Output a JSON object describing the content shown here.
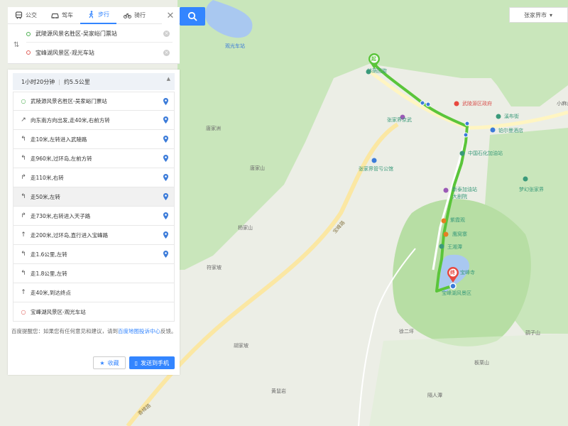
{
  "modes": [
    {
      "label": "公交",
      "icon": "bus-icon"
    },
    {
      "label": "驾车",
      "icon": "car-icon"
    },
    {
      "label": "步行",
      "icon": "walk-icon",
      "active": true
    },
    {
      "label": "骑行",
      "icon": "bike-icon"
    }
  ],
  "search": {
    "close": "✕"
  },
  "route": {
    "start": "武陵源风景名胜区-吴家峪门票站",
    "end": "宝峰湖风景区-观光车站"
  },
  "summary": {
    "duration": "1小时20分钟",
    "distance": "约5.5公里"
  },
  "steps": [
    {
      "text": "武陵源风景名胜区-吴家峪门票站",
      "type": "start",
      "pin": true
    },
    {
      "text": "向东南方向出发,走40米,右前方转",
      "type": "right-front",
      "pin": true
    },
    {
      "text": "走10米,左转进入武陵路",
      "type": "left",
      "pin": true
    },
    {
      "text": "走960米,过环岛,左前方转",
      "type": "left",
      "pin": true
    },
    {
      "text": "走110米,右转",
      "type": "right",
      "pin": true
    },
    {
      "text": "走50米,左转",
      "type": "left",
      "pin": true,
      "highlight": true
    },
    {
      "text": "走730米,右转进入天子路",
      "type": "right",
      "pin": true
    },
    {
      "text": "走200米,过环岛,直行进入宝峰路",
      "type": "straight",
      "pin": true
    },
    {
      "text": "走1.6公里,左转",
      "type": "left",
      "pin": true
    },
    {
      "text": "走1.8公里,左转",
      "type": "left",
      "pin": false
    },
    {
      "text": "走40米,到达终点",
      "type": "straight",
      "pin": false
    },
    {
      "text": "宝峰湖风景区-观光车站",
      "type": "end",
      "pin": false
    }
  ],
  "tip": {
    "text": "百度提醒您：如果您有任何意见和建议，请到",
    "link": "百度地图投诉中心",
    "tail": "反馈。"
  },
  "buttons": {
    "favorite": "收藏",
    "send": "发送到手机"
  },
  "city": {
    "label": "张家界市"
  },
  "map_labels": {
    "start_marker": "起",
    "end_marker": "终",
    "pois": [
      {
        "text": "林荫回旋",
        "kind": "poi"
      },
      {
        "text": "武陵源区政府",
        "kind": "red"
      },
      {
        "text": "溪布街",
        "kind": "poi"
      },
      {
        "text": "张家界京武",
        "kind": "poi"
      },
      {
        "text": "铂尔曼酒店",
        "kind": "poi"
      },
      {
        "text": "中国石化加油站",
        "kind": "poi"
      },
      {
        "text": "张家界管亏公馆",
        "kind": "poi"
      },
      {
        "text": "新泰加油站",
        "kind": "poi"
      },
      {
        "text": "梦幻张家界",
        "kind": "poi"
      },
      {
        "text": "大剧院",
        "kind": "poi"
      },
      {
        "text": "紫霞观",
        "kind": "poi"
      },
      {
        "text": "鹰窝寨",
        "kind": "poi"
      },
      {
        "text": "王湘潭",
        "kind": "poi"
      },
      {
        "text": "宝峰寺",
        "kind": "poi"
      },
      {
        "text": "宝峰湖风景区",
        "kind": "poi"
      },
      {
        "text": "观光车站",
        "kind": "blue"
      },
      {
        "text": "唐家洲",
        "kind": "plain"
      },
      {
        "text": "唐家山",
        "kind": "plain"
      },
      {
        "text": "杨家山",
        "kind": "plain"
      },
      {
        "text": "符家坡",
        "kind": "plain"
      },
      {
        "text": "徐二坪",
        "kind": "plain"
      },
      {
        "text": "鹞子山",
        "kind": "plain"
      },
      {
        "text": "胡家坡",
        "kind": "plain"
      },
      {
        "text": "板栗山",
        "kind": "plain"
      },
      {
        "text": "黄鼠岩",
        "kind": "plain"
      },
      {
        "text": "隔人潭",
        "kind": "plain"
      },
      {
        "text": "小麻山",
        "kind": "plain"
      },
      {
        "text": "中",
        "kind": "blue"
      }
    ],
    "roads": [
      "宝峰路",
      "香樟路"
    ]
  },
  "colors": {
    "accent": "#3385ff",
    "route": "#5ac53a",
    "water": "#a9c8f0",
    "forest": "#c9e6bb"
  }
}
